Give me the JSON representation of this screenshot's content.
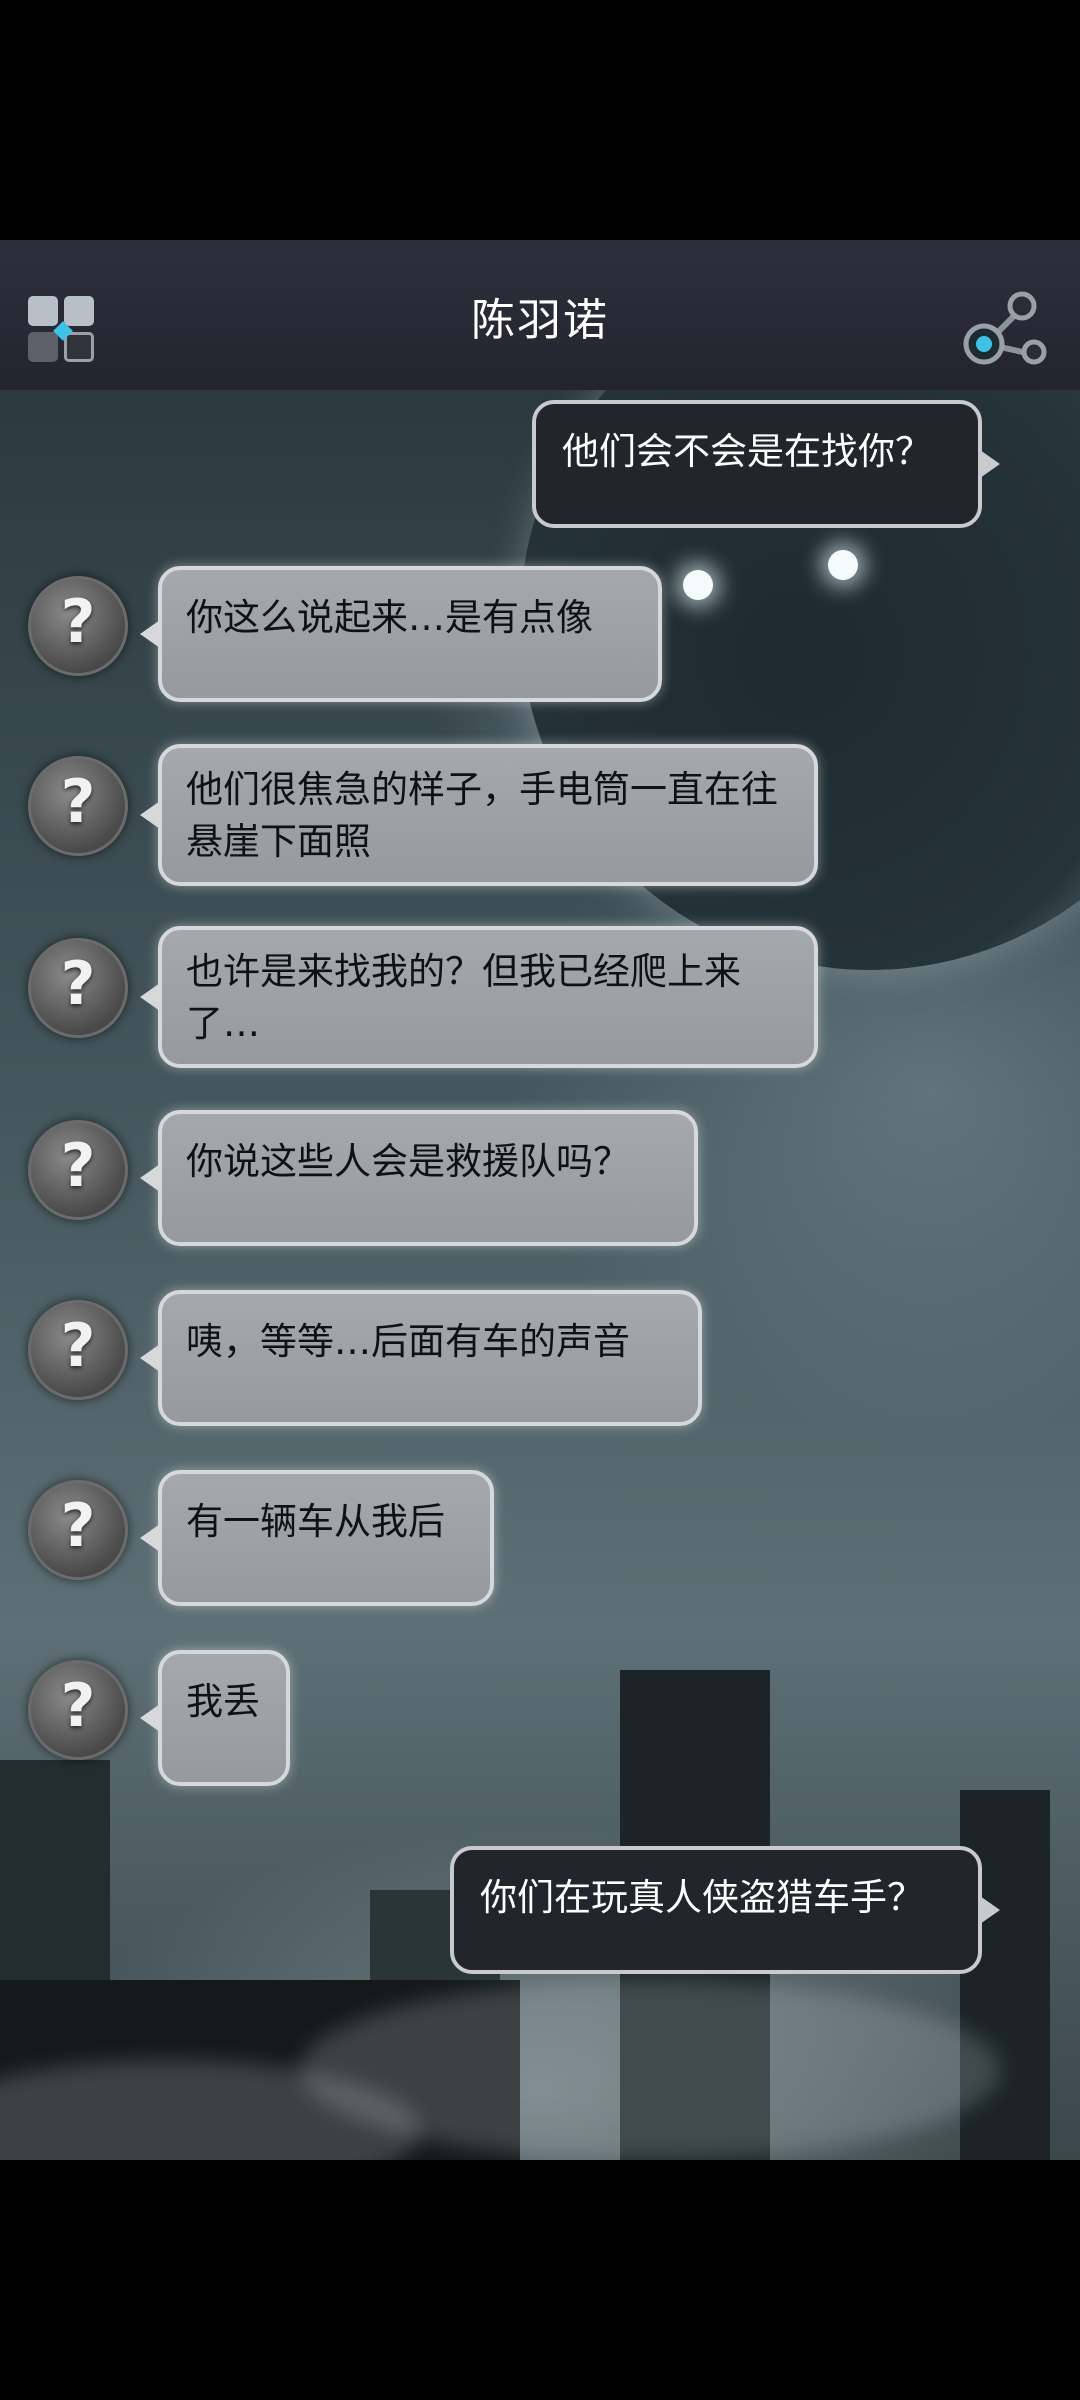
{
  "header": {
    "title": "陈羽诺",
    "menu_icon": "grid-menu-icon",
    "share_icon": "share-nodes-icon"
  },
  "messages": [
    {
      "side": "out",
      "text": "他们会不会是在找你？"
    },
    {
      "side": "in",
      "avatar": "?",
      "text": "你这么说起来…是有点像"
    },
    {
      "side": "in",
      "avatar": "?",
      "text": "他们很焦急的样子，手电筒一直在往悬崖下面照"
    },
    {
      "side": "in",
      "avatar": "?",
      "text": "也许是来找我的？但我已经爬上来了…"
    },
    {
      "side": "in",
      "avatar": "?",
      "text": "你说这些人会是救援队吗？"
    },
    {
      "side": "in",
      "avatar": "?",
      "text": "咦，等等…后面有车的声音"
    },
    {
      "side": "in",
      "avatar": "?",
      "text": "有一辆车从我后"
    },
    {
      "side": "in",
      "avatar": "?",
      "text": "我丢"
    },
    {
      "side": "out",
      "text": "你们在玩真人侠盗猎车手？"
    }
  ],
  "colors": {
    "header_bg": "#2d2f3b",
    "incoming_bubble": "#a5a9ad",
    "outgoing_bubble": "#23252c",
    "bubble_border": "#d6d8da"
  }
}
